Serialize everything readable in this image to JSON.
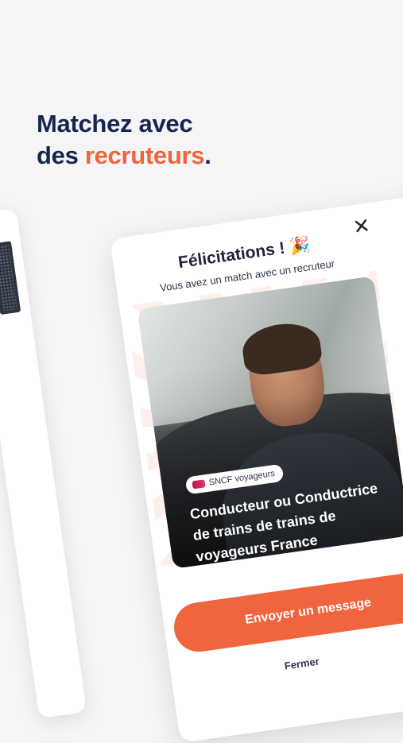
{
  "headline": {
    "line1": "Matchez avec",
    "line2_prefix": "des ",
    "line2_accent": "recruteurs",
    "line2_suffix": "."
  },
  "modal": {
    "title": "Félicitations !",
    "title_emoji": "🎉",
    "subtitle": "Vous avez un match avec un recruteur",
    "close_icon": "✕",
    "company_badge": "SNCF voyageurs",
    "job_title": "Conducteur ou Conductrice de trains de trains de voyageurs France",
    "primary_button": "Envoyer un message",
    "secondary_link": "Fermer"
  },
  "colors": {
    "navy": "#16264f",
    "accent": "#f0643c",
    "background": "#f5f5f7"
  }
}
